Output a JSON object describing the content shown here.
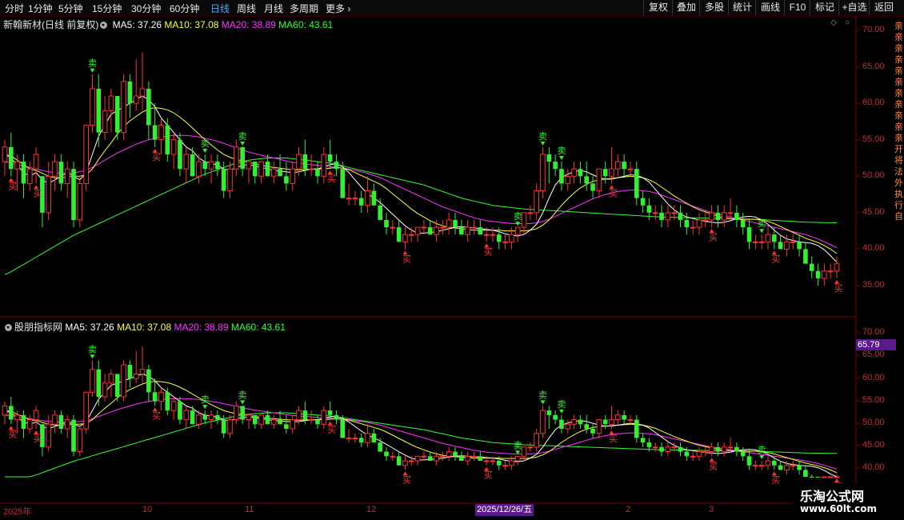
{
  "toolbar": {
    "periods": [
      "分时",
      "1分钟",
      "5分钟",
      "15分钟",
      "30分钟",
      "60分钟",
      "日线",
      "周线",
      "月线",
      "多周期",
      "更多"
    ],
    "active_period": "日线",
    "tools": [
      "复权",
      "叠加",
      "多股",
      "统计",
      "画线",
      "F10",
      "标记",
      "+自选",
      "返回"
    ]
  },
  "main_panel": {
    "title": "新翰新材(日线 前复权)",
    "ma5": "MA5: 37.26",
    "ma10": "MA10: 37.08",
    "ma20": "MA20: 38.89",
    "ma60": "MA60: 43.61",
    "y_ticks": [
      "70.00",
      "65.00",
      "60.00",
      "55.00",
      "50.00",
      "45.00",
      "40.00",
      "35.00"
    ]
  },
  "sub_panel": {
    "title": "股朋指标网",
    "ma5": "MA5: 37.26",
    "ma10": "MA10: 37.08",
    "ma20": "MA20: 38.89",
    "ma60": "MA60: 43.61",
    "y_ticks": [
      "70.00",
      "65.00",
      "60.00",
      "55.00",
      "50.00",
      "45.00",
      "40.00"
    ],
    "current_price": "65.79"
  },
  "x_axis": {
    "labels": [
      "2025年",
      "10",
      "11",
      "12",
      "2",
      "3"
    ],
    "cursor_date": "2025/12/26/五"
  },
  "signals": {
    "buy": "买",
    "sell": "卖"
  },
  "watermark": {
    "line1": "乐淘公式网",
    "line2": "www.60lt.com"
  },
  "side_text": "亲亲亲亲亲亲亲亲亲亲亲开将法外执行自",
  "colors": {
    "up": "#ff3333",
    "down": "#33ee33",
    "ma5": "#ffffff",
    "ma10": "#ffff33",
    "ma20": "#ff33ff",
    "ma60": "#33ff33",
    "accent": "#4aa8ff"
  },
  "chart_data": {
    "type": "candlestick",
    "ylim": [
      33,
      72
    ],
    "candles": [
      [
        52,
        55,
        50,
        54
      ],
      [
        54,
        56,
        50,
        51
      ],
      [
        51,
        53,
        48,
        52
      ],
      [
        52,
        53,
        47,
        49
      ],
      [
        49,
        52,
        48,
        51
      ],
      [
        51,
        54,
        49,
        53
      ],
      [
        50,
        50,
        43,
        45
      ],
      [
        45,
        52,
        44,
        50
      ],
      [
        50,
        53,
        48,
        52
      ],
      [
        52,
        53,
        48,
        49
      ],
      [
        49,
        52,
        47,
        51
      ],
      [
        51,
        52,
        43,
        44
      ],
      [
        44,
        50,
        43,
        49
      ],
      [
        49,
        57,
        48,
        57
      ],
      [
        57,
        64,
        56,
        62
      ],
      [
        62,
        64,
        54,
        56
      ],
      [
        56,
        61,
        55,
        59
      ],
      [
        59,
        62,
        56,
        61
      ],
      [
        61,
        61,
        55,
        56
      ],
      [
        56,
        64,
        55,
        63
      ],
      [
        63,
        64,
        58,
        60
      ],
      [
        60,
        66,
        59,
        61
      ],
      [
        61,
        67,
        59,
        62
      ],
      [
        62,
        63,
        55,
        57
      ],
      [
        57,
        60,
        54,
        55
      ],
      [
        55,
        58,
        53,
        57
      ],
      [
        57,
        58,
        52,
        53
      ],
      [
        53,
        56,
        51,
        55
      ],
      [
        55,
        56,
        50,
        51
      ],
      [
        51,
        54,
        49,
        53
      ],
      [
        53,
        54,
        50,
        50
      ],
      [
        50,
        53,
        49,
        52
      ],
      [
        52,
        53,
        50,
        51
      ],
      [
        51,
        53,
        49,
        52
      ],
      [
        52,
        53,
        50,
        51
      ],
      [
        51,
        52,
        47,
        48
      ],
      [
        48,
        52,
        47,
        51
      ],
      [
        51,
        55,
        50,
        54
      ],
      [
        54,
        54,
        50,
        51
      ],
      [
        51,
        52,
        49,
        52
      ],
      [
        52,
        52,
        49,
        50
      ],
      [
        50,
        52,
        49,
        52
      ],
      [
        52,
        53,
        50,
        50
      ],
      [
        50,
        52,
        49,
        51
      ],
      [
        51,
        53,
        50,
        50
      ],
      [
        50,
        52,
        48,
        49
      ],
      [
        49,
        52,
        48,
        51
      ],
      [
        51,
        54,
        50,
        53
      ],
      [
        53,
        55,
        50,
        51
      ],
      [
        51,
        53,
        50,
        51
      ],
      [
        51,
        52,
        49,
        50
      ],
      [
        50,
        54,
        49,
        53
      ],
      [
        53,
        55,
        51,
        52
      ],
      [
        52,
        53,
        50,
        51
      ],
      [
        51,
        52,
        47,
        47
      ],
      [
        47,
        49,
        46,
        47
      ],
      [
        47,
        48,
        46,
        47
      ],
      [
        47,
        48,
        45,
        46
      ],
      [
        46,
        50,
        45,
        48
      ],
      [
        48,
        49,
        46,
        46
      ],
      [
        46,
        47,
        44,
        44
      ],
      [
        44,
        45,
        42,
        43
      ],
      [
        43,
        44,
        42,
        43
      ],
      [
        43,
        44,
        41,
        41
      ],
      [
        41,
        43,
        40,
        42
      ],
      [
        42,
        43,
        41,
        42
      ],
      [
        42,
        43,
        41,
        43
      ],
      [
        43,
        44,
        42,
        43
      ],
      [
        43,
        44,
        42,
        42
      ],
      [
        42,
        44,
        41,
        43
      ],
      [
        43,
        44,
        42,
        43
      ],
      [
        43,
        45,
        42,
        44
      ],
      [
        44,
        45,
        42,
        43
      ],
      [
        43,
        44,
        42,
        42
      ],
      [
        42,
        44,
        41,
        43
      ],
      [
        43,
        44,
        42,
        43
      ],
      [
        43,
        44,
        42,
        42
      ],
      [
        42,
        43,
        41,
        42
      ],
      [
        42,
        43,
        41,
        42
      ],
      [
        42,
        43,
        40,
        41
      ],
      [
        41,
        42,
        40,
        41
      ],
      [
        41,
        43,
        40,
        42
      ],
      [
        42,
        43,
        41,
        43
      ],
      [
        43,
        45,
        42,
        45
      ],
      [
        45,
        46,
        44,
        45
      ],
      [
        45,
        49,
        44,
        48
      ],
      [
        48,
        54,
        47,
        53
      ],
      [
        53,
        54,
        49,
        52
      ],
      [
        52,
        53,
        50,
        51
      ],
      [
        51,
        52,
        48,
        49
      ],
      [
        49,
        51,
        48,
        50
      ],
      [
        50,
        52,
        49,
        51
      ],
      [
        51,
        52,
        49,
        50
      ],
      [
        50,
        52,
        48,
        49
      ],
      [
        49,
        50,
        47,
        48
      ],
      [
        48,
        51,
        47,
        51
      ],
      [
        51,
        52,
        49,
        50
      ],
      [
        50,
        54,
        49,
        51
      ],
      [
        51,
        53,
        50,
        52
      ],
      [
        52,
        53,
        50,
        51
      ],
      [
        51,
        52,
        50,
        51
      ],
      [
        51,
        52,
        46,
        47
      ],
      [
        47,
        48,
        45,
        46
      ],
      [
        46,
        47,
        44,
        45
      ],
      [
        45,
        46,
        44,
        45
      ],
      [
        45,
        46,
        43,
        44
      ],
      [
        44,
        46,
        43,
        45
      ],
      [
        45,
        46,
        44,
        45
      ],
      [
        45,
        46,
        43,
        44
      ],
      [
        44,
        45,
        42,
        43
      ],
      [
        43,
        44,
        42,
        43
      ],
      [
        43,
        45,
        42,
        44
      ],
      [
        44,
        45,
        43,
        44
      ],
      [
        44,
        46,
        43,
        45
      ],
      [
        45,
        46,
        43,
        44
      ],
      [
        44,
        46,
        43,
        45
      ],
      [
        45,
        47,
        44,
        45
      ],
      [
        45,
        46,
        43,
        44
      ],
      [
        44,
        45,
        42,
        43
      ],
      [
        43,
        44,
        40,
        41
      ],
      [
        41,
        42,
        40,
        41
      ],
      [
        41,
        42,
        40,
        41
      ],
      [
        41,
        43,
        40,
        42
      ],
      [
        42,
        43,
        40,
        41
      ],
      [
        41,
        42,
        40,
        40
      ],
      [
        40,
        42,
        39,
        41
      ],
      [
        41,
        42,
        40,
        41
      ],
      [
        41,
        42,
        39,
        40
      ],
      [
        40,
        41,
        38,
        38
      ],
      [
        38,
        39,
        36,
        37
      ],
      [
        37,
        38,
        35,
        36
      ],
      [
        36,
        38,
        35,
        37
      ],
      [
        37,
        38,
        36,
        37
      ],
      [
        37,
        39,
        36,
        38
      ]
    ],
    "ma5": [
      53,
      52.5,
      51.5,
      50.5,
      50,
      50.5,
      49.5,
      49,
      49.5,
      50,
      50.5,
      50,
      49.5,
      50.5,
      53,
      55.5,
      57,
      58.5,
      59,
      59.5,
      60,
      60.5,
      61,
      60.5,
      59.5,
      58,
      57,
      56,
      55,
      54,
      53.5,
      52.5,
      52,
      51.8,
      51.5,
      51,
      50.8,
      51.2,
      51.5,
      51.6,
      51.4,
      51.2,
      51,
      50.8,
      50.7,
      50.6,
      50.5,
      50.6,
      50.8,
      51,
      51,
      51.3,
      51.6,
      51.7,
      51.3,
      50.5,
      49.5,
      48.5,
      47.6,
      47,
      46.4,
      45.6,
      44.8,
      44,
      43.2,
      42.6,
      42.2,
      42.2,
      42.3,
      42.4,
      42.6,
      42.8,
      43,
      43.1,
      43,
      42.9,
      42.8,
      42.7,
      42.6,
      42.4,
      42.1,
      41.9,
      41.8,
      42,
      42.6,
      43.4,
      45,
      47,
      48.8,
      49.8,
      50.3,
      50.6,
      50.8,
      50.6,
      50.2,
      49.8,
      49.6,
      49.6,
      49.8,
      50,
      50.2,
      50.1,
      49.8,
      49.2,
      48.2,
      47.2,
      46.2,
      45.4,
      44.8,
      44.4,
      44.2,
      44,
      43.8,
      43.7,
      43.6,
      43.7,
      43.9,
      44.2,
      44.4,
      44.5,
      44.4,
      44,
      43.4,
      42.6,
      41.9,
      41.4,
      41.2,
      41,
      40.9,
      40.8,
      40.5,
      39.9,
      39.1,
      38.2,
      37.6,
      37.3,
      37.2,
      37.26
    ],
    "ma10": [
      53,
      52.8,
      52.2,
      51.6,
      51,
      50.8,
      50.4,
      50,
      49.8,
      49.8,
      49.9,
      50,
      50,
      50.2,
      51,
      52.3,
      53.5,
      54.6,
      55.8,
      56.8,
      57.6,
      58.2,
      58.8,
      59.2,
      59.4,
      59.3,
      59.1,
      58.7,
      58.1,
      57.4,
      56.6,
      55.8,
      55,
      54.3,
      53.6,
      53,
      52.6,
      52.3,
      52.1,
      51.9,
      51.7,
      51.5,
      51.3,
      51.2,
      51.1,
      51,
      50.9,
      50.9,
      50.9,
      51,
      51,
      51,
      51.1,
      51.2,
      51.1,
      50.9,
      50.5,
      50.1,
      49.7,
      49.3,
      48.9,
      48.3,
      47.6,
      46.9,
      46.2,
      45.5,
      44.9,
      44.4,
      43.9,
      43.5,
      43.2,
      43,
      42.9,
      42.8,
      42.7,
      42.6,
      42.6,
      42.6,
      42.6,
      42.6,
      42.5,
      42.5,
      42.5,
      42.5,
      42.6,
      42.8,
      43.3,
      44,
      45,
      46,
      46.9,
      47.7,
      48.4,
      48.9,
      49.3,
      49.5,
      49.6,
      49.7,
      49.8,
      49.9,
      50,
      49.9,
      49.8,
      49.5,
      49.1,
      48.5,
      47.9,
      47.3,
      46.8,
      46.3,
      45.8,
      45.4,
      45.1,
      44.8,
      44.5,
      44.3,
      44.2,
      44.1,
      44.1,
      44.1,
      44.1,
      44,
      43.8,
      43.5,
      43.1,
      42.7,
      42.3,
      41.9,
      41.5,
      41.2,
      40.9,
      40.5,
      40,
      39.4,
      38.8,
      38.2,
      37.6,
      37.08
    ],
    "ma20": [
      52,
      51.8,
      51.6,
      51.4,
      51.2,
      51,
      50.8,
      50.6,
      50.5,
      50.4,
      50.4,
      50.5,
      50.6,
      50.8,
      51.2,
      51.7,
      52.2,
      52.7,
      53.2,
      53.6,
      54,
      54.4,
      54.7,
      55,
      55.2,
      55.4,
      55.5,
      55.6,
      55.6,
      55.6,
      55.5,
      55.4,
      55.2,
      55,
      54.8,
      54.5,
      54.2,
      53.9,
      53.6,
      53.3,
      53.1,
      52.9,
      52.7,
      52.5,
      52.3,
      52.1,
      51.9,
      51.8,
      51.7,
      51.6,
      51.5,
      51.4,
      51.3,
      51.2,
      51.1,
      51,
      50.8,
      50.6,
      50.4,
      50.1,
      49.8,
      49.4,
      49,
      48.6,
      48.2,
      47.8,
      47.4,
      47,
      46.6,
      46.2,
      45.8,
      45.5,
      45.2,
      44.9,
      44.6,
      44.3,
      44.1,
      43.9,
      43.8,
      43.7,
      43.6,
      43.5,
      43.5,
      43.5,
      43.5,
      43.6,
      43.8,
      44.1,
      44.5,
      44.9,
      45.3,
      45.7,
      46.1,
      46.5,
      46.9,
      47.2,
      47.5,
      47.7,
      47.9,
      48,
      48.1,
      48.1,
      48,
      47.9,
      47.7,
      47.4,
      47.1,
      46.8,
      46.5,
      46.2,
      45.9,
      45.6,
      45.3,
      45,
      44.8,
      44.6,
      44.4,
      44.2,
      44,
      43.8,
      43.6,
      43.4,
      43.2,
      43,
      42.8,
      42.6,
      42.4,
      42.2,
      42,
      41.7,
      41.4,
      41,
      40.6,
      40.2,
      39.8,
      39.4,
      38.89
    ],
    "ma60": [
      36.5,
      36.9,
      37.4,
      37.9,
      38.4,
      38.9,
      39.4,
      39.9,
      40.4,
      40.9,
      41.4,
      41.9,
      42.3,
      42.7,
      43.1,
      43.5,
      43.9,
      44.3,
      44.7,
      45.1,
      45.5,
      45.9,
      46.3,
      46.7,
      47.1,
      47.5,
      47.9,
      48.3,
      48.7,
      49.1,
      49.5,
      49.9,
      50.3,
      50.6,
      50.9,
      51.2,
      51.5,
      51.8,
      52,
      52.2,
      52.3,
      52.4,
      52.5,
      52.5,
      52.5,
      52.5,
      52.4,
      52.3,
      52.2,
      52.1,
      52,
      51.9,
      51.8,
      51.6,
      51.4,
      51.2,
      51,
      50.8,
      50.6,
      50.4,
      50.2,
      50,
      49.8,
      49.6,
      49.4,
      49.2,
      49,
      48.8,
      48.5,
      48.2,
      47.9,
      47.6,
      47.3,
      47,
      46.8,
      46.6,
      46.4,
      46.2,
      46,
      45.9,
      45.8,
      45.7,
      45.6,
      45.5,
      45.45,
      45.4,
      45.35,
      45.3,
      45.25,
      45.2,
      45.15,
      45.1,
      45.05,
      45,
      44.95,
      44.9,
      44.85,
      44.8,
      44.75,
      44.7,
      44.65,
      44.6,
      44.55,
      44.5,
      44.45,
      44.4,
      44.38,
      44.36,
      44.34,
      44.32,
      44.3,
      44.28,
      44.26,
      44.24,
      44.22,
      44.2,
      44.18,
      44.16,
      44.14,
      44.12,
      44.1,
      44.05,
      44,
      43.95,
      43.9,
      43.85,
      43.8,
      43.75,
      43.7,
      43.68,
      43.66,
      43.64,
      43.62,
      43.61
    ],
    "buy_idx": [
      1,
      5,
      24,
      52,
      64,
      77,
      97,
      113,
      123,
      133
    ],
    "sell_idx": [
      14,
      32,
      38,
      86,
      82,
      89,
      121
    ]
  }
}
